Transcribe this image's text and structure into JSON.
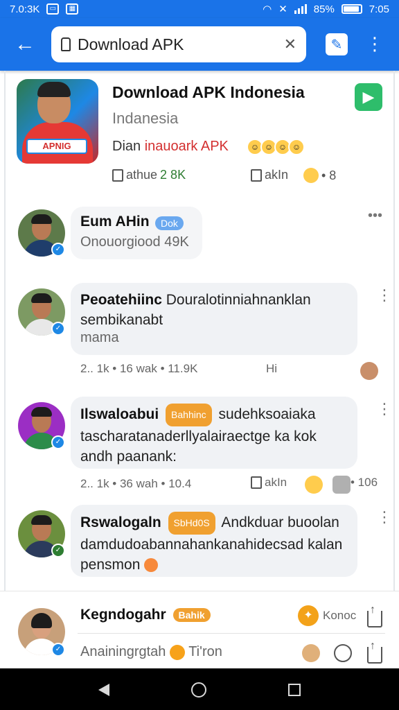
{
  "status_bar": {
    "left_text": "7.0:3K",
    "battery_text": "85%",
    "time": "7:05"
  },
  "app_bar": {
    "search_value": "Download APK"
  },
  "app": {
    "title": "Download APK Indonesia",
    "subtitle": "Indanesia",
    "developer_prefix": "Dian",
    "developer_name": "inauoark APK",
    "icon_label": "APNIG",
    "stat_share_label": "athue",
    "stat_share_value": "2 8K",
    "stat_ask_label": "akIn",
    "stat_extra": "• 8"
  },
  "comments": [
    {
      "name": "Eum AHin",
      "badge": "Dok",
      "text": "Onouorgiood 49K"
    },
    {
      "name": "Peoatehiinc",
      "text_inline": "Douraloti­nniahnanklan",
      "text": "sembikanabt",
      "text2": "mama",
      "meta": "2.. 1k • 16 wak • 11.9K",
      "meta_mid": "Hi"
    },
    {
      "name": "Ilswaloabui",
      "badge": "Bahhinc",
      "text_inline": "sudehksoaiaka",
      "text": "tascharatanaderllyalairaectge ka kok",
      "text2": "andh paanank:",
      "meta": "2.. 1k • 36 wah • 10.4",
      "meta_ask": "akIn",
      "meta_right": "• 106"
    },
    {
      "name": "Rswalogaln",
      "badge": "SbHd0S",
      "text_inline": "Andkduar buoolan",
      "text": "damdudoabannahankanahidecsad kalan",
      "text2": "pensmon"
    }
  ],
  "composer": {
    "name": "Kegndogahr",
    "badge": "Bahik",
    "like_label": "Konoc",
    "sub": "Anainingrgtah",
    "sub_tail": "Ti'ron"
  }
}
